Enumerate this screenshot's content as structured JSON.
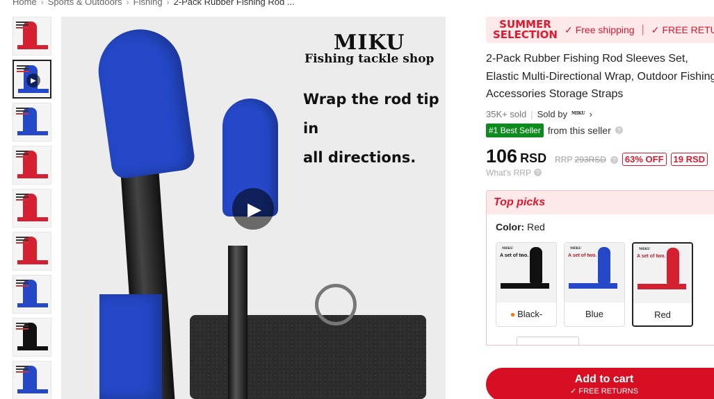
{
  "breadcrumb": {
    "items": [
      "Home",
      "Sports & Outdoors",
      "Fishing"
    ],
    "current": "2-Pack Rubber Fishing Rod ..."
  },
  "thumbnails": [
    {
      "color": "#d42030",
      "kind": "product"
    },
    {
      "color": "#2448c8",
      "kind": "video"
    },
    {
      "color": "#2448c8",
      "kind": "product"
    },
    {
      "color": "#d42030",
      "kind": "product"
    },
    {
      "color": "#d42030",
      "kind": "product"
    },
    {
      "color": "#d42030",
      "kind": "product"
    },
    {
      "color": "#2448c8",
      "kind": "product"
    },
    {
      "color": "#111111",
      "kind": "product"
    },
    {
      "color": "#2448c8",
      "kind": "product"
    }
  ],
  "main_image": {
    "brand": "MIKU",
    "brand_sub": "Fishing tackle shop",
    "tagline": "Wrap the rod tip in\nall directions."
  },
  "promo": {
    "selection_line1": "SUMMER",
    "selection_line2": "SELECTION",
    "free_shipping": "Free shipping",
    "free_returns": "FREE RETURNS"
  },
  "product": {
    "title": "2-Pack Rubber Fishing Rod Sleeves Set, Elastic Multi-Directional Wrap, Outdoor Fishing Accessories Storage Straps",
    "sold": "35K+ sold",
    "sold_by": "Sold by",
    "seller_logo": "MIKU",
    "best_seller_badge": "#1 Best Seller",
    "best_seller_text": "from this seller",
    "price": "106",
    "currency": "RSD",
    "rrp_label": "RRP",
    "rrp_value": "293RSD",
    "discount": "63% OFF",
    "saving": "19 RSD",
    "whats_rrp": "What's RRP"
  },
  "top_picks": {
    "heading": "Top picks",
    "color_label": "Color:",
    "color_value": "Red",
    "options": [
      {
        "label": "Black-",
        "color": "#111111",
        "hot": true
      },
      {
        "label": "Blue",
        "color": "#2448c8",
        "hot": false
      },
      {
        "label": "Red",
        "color": "#d42030",
        "hot": false
      }
    ],
    "swatch_brand": "MIKU",
    "swatch_text": "A set of two."
  },
  "cart": {
    "label": "Add to cart",
    "sub": "FREE RETURNS"
  },
  "colors": {
    "accent": "#e0182d",
    "cart": "#d80e22",
    "best_seller": "#0f8a1f"
  }
}
